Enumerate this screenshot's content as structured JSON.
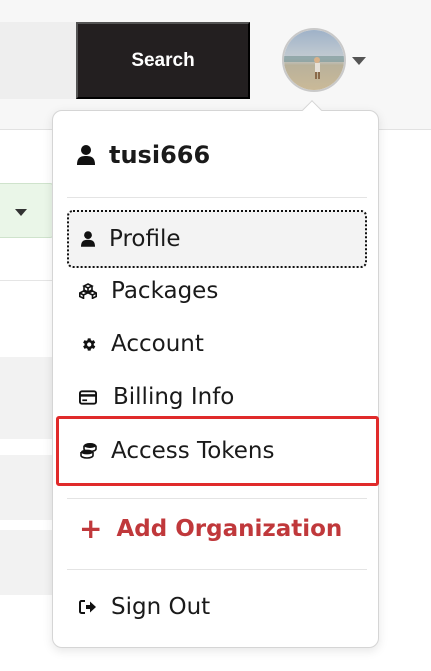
{
  "header": {
    "search_label": "Search"
  },
  "user_menu": {
    "username": "tusi666",
    "items": [
      {
        "label": "Profile",
        "icon": "user-icon"
      },
      {
        "label": "Packages",
        "icon": "cubes-icon"
      },
      {
        "label": "Account",
        "icon": "gear-icon"
      },
      {
        "label": "Billing Info",
        "icon": "credit-card-icon"
      },
      {
        "label": "Access Tokens",
        "icon": "coins-icon"
      }
    ],
    "add_org_label": "Add Organization",
    "sign_out_label": "Sign Out"
  },
  "colors": {
    "search_button_bg": "#231f20",
    "add_org_red": "#c0383b",
    "annotation_red": "#e02a2a"
  }
}
